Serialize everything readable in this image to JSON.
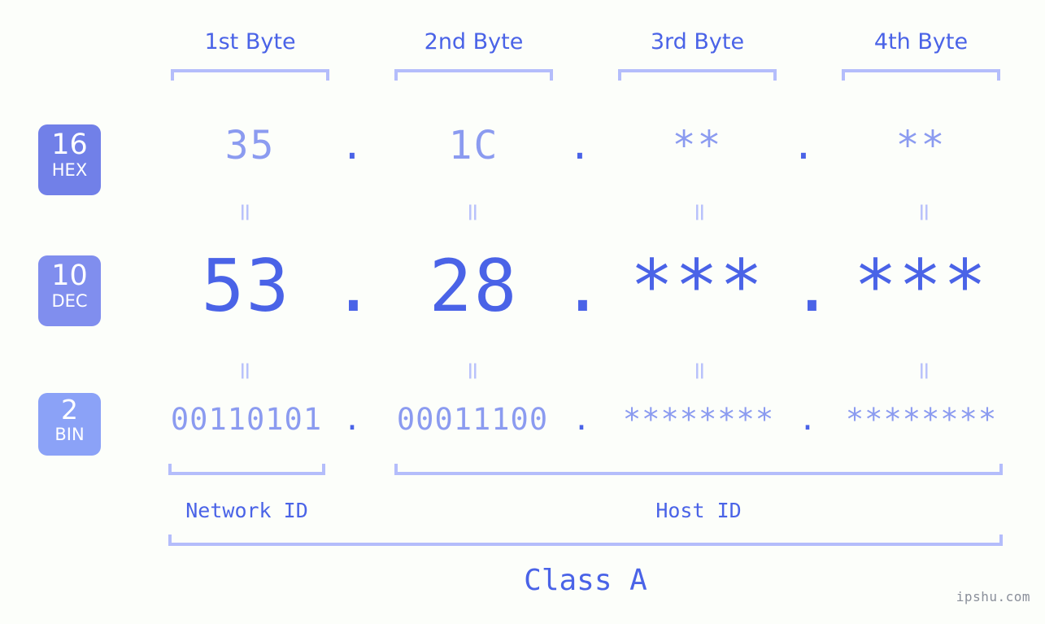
{
  "meta": {
    "background_color": "#fcfefa",
    "accent_color": "#4a63e7",
    "accent_light_color": "#8b9bf0",
    "bracket_color": "#b4bdfb",
    "watermark": "ipshu.com"
  },
  "columns": {
    "headers": [
      "1st Byte",
      "2nd Byte",
      "3rd Byte",
      "4th Byte"
    ]
  },
  "radix_badges": [
    {
      "number": "16",
      "word": "HEX",
      "color": "#7180e8"
    },
    {
      "number": "10",
      "word": "DEC",
      "color": "#808eee"
    },
    {
      "number": "2",
      "word": "BIN",
      "color": "#8ba2f7"
    }
  ],
  "rows": {
    "hex": {
      "values": [
        "35",
        "1C",
        "**",
        "**"
      ],
      "separator": "."
    },
    "dec": {
      "values": [
        "53",
        "28",
        "***",
        "***"
      ],
      "separator": "."
    },
    "bin": {
      "values": [
        "00110101",
        "00011100",
        "********",
        "********"
      ],
      "separator": "."
    }
  },
  "equals_marks": {
    "glyph": "=",
    "count_per_gap": 4,
    "gaps": [
      "hex-to-dec",
      "dec-to-bin"
    ]
  },
  "id_sections": {
    "network_id": "Network ID",
    "host_id": "Host ID"
  },
  "class_label": "Class A"
}
